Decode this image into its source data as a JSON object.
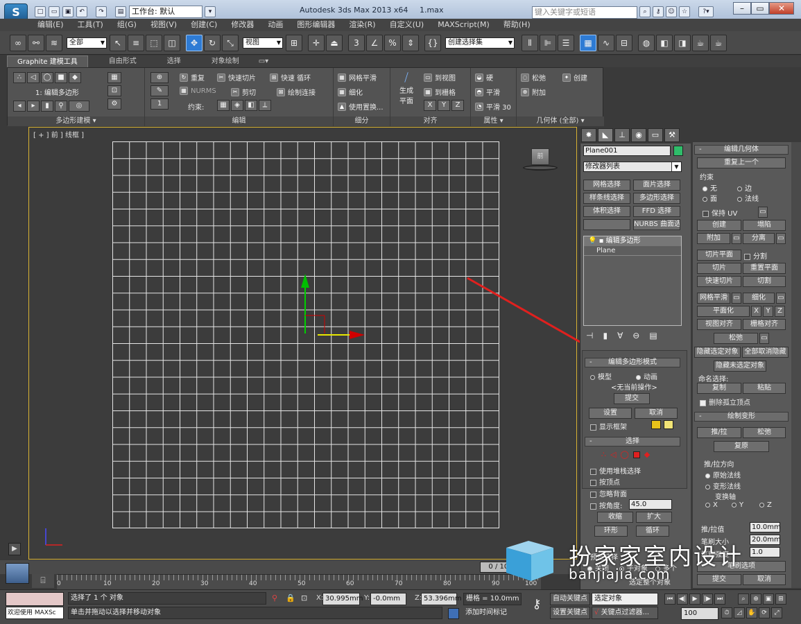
{
  "window": {
    "app_title": "Autodesk 3ds Max  2013 x64",
    "file": "1.max",
    "workspace_label": "工作台: 默认",
    "search_placeholder": "键入关键字或短语"
  },
  "menu": [
    "编辑(E)",
    "工具(T)",
    "组(G)",
    "视图(V)",
    "创建(C)",
    "修改器",
    "动画",
    "图形编辑器",
    "渲染(R)",
    "自定义(U)",
    "MAXScript(M)",
    "帮助(H)"
  ],
  "toolbar": {
    "filter_value": "全部",
    "refcoord_value": "视图",
    "selset_value": "创建选择集"
  },
  "ribbon": {
    "tabs": [
      "Graphite 建模工具",
      "自由形式",
      "选择",
      "对象绘制"
    ],
    "poly_mode_label": "1: 编辑多边形",
    "group_footers": [
      "多边形建模 ▾",
      "编辑",
      "细分",
      "对齐",
      "属性 ▾",
      "几何体 (全部) ▾"
    ],
    "spinner_value": "1",
    "edit": [
      "重复",
      "快速切片",
      "快速 循环",
      "NURMS",
      "剪切",
      "绘制连接",
      "约束:"
    ],
    "subdiv": [
      "网格平滑",
      "细化",
      "使用置换..."
    ],
    "align": [
      "生成\n平面",
      "到视图",
      "到栅格"
    ],
    "align_xyz": [
      "X",
      "Y",
      "Z"
    ],
    "props": [
      "硬",
      "平滑",
      "平滑 30"
    ],
    "geom": [
      "松弛",
      "创建",
      "附加"
    ]
  },
  "viewport": {
    "label": "[ + ] 前 ] 线框 ]",
    "cube_label": "前"
  },
  "command_panel": {
    "object_name": "Plane001",
    "object_color": "#2fbd6a",
    "modifier_list": "修改器列表",
    "mod_buttons": [
      "网格选择",
      "面片选择",
      "样条线选择",
      "多边形选择",
      "体积选择",
      "FFD 选择",
      "NURBS 曲面选择"
    ],
    "stack": [
      "编辑多边形",
      "Plane"
    ],
    "edit_poly_mode": {
      "title": "编辑多边形模式",
      "opt_model": "模型",
      "opt_anim": "动画",
      "no_op": "<无当前操作>",
      "commit": "提交",
      "settings": "设置",
      "cancel": "取消",
      "show_cage": "显示框架"
    },
    "selection": {
      "title": "选择",
      "use_stack": "使用堆栈选择",
      "by_vertex": "按顶点",
      "ignore_back": "忽略背面",
      "by_angle": "按角度:",
      "angle_value": "45.0",
      "shrink": "收缩",
      "grow": "扩大",
      "ring": "环形",
      "loop": "循环",
      "preview": "预览选择",
      "off": "关闭",
      "subobj": "子对象",
      "multi": "多个",
      "whole": "选定整个对象"
    }
  },
  "right_panel": {
    "edit_geom": {
      "title": "编辑几何体",
      "repeat": "重复上一个",
      "constraint": "约束",
      "none": "无",
      "edge": "边",
      "face": "面",
      "normal": "法线",
      "keep_uv": "保持 UV",
      "create": "创建",
      "collapse": "塌陷",
      "attach": "附加",
      "detach": "分离",
      "slice_plane": "切片平面",
      "split": "分割",
      "slice": "切片",
      "reset_plane": "重置平面",
      "quickslice": "快速切片",
      "cut": "切割",
      "msmooth": "网格平滑",
      "tessellate": "细化",
      "planarize": "平面化",
      "x": "X",
      "y": "Y",
      "z": "Z",
      "view_align": "视图对齐",
      "grid_align": "栅格对齐",
      "relax": "松弛",
      "hide_sel": "隐藏选定对象",
      "unhide_all": "全部取消隐藏",
      "hide_unsel": "隐藏未选定对象",
      "named_sel": "命名选择:",
      "copy": "复制",
      "paste": "粘贴",
      "del_iso": "删除孤立顶点"
    },
    "paint_deform": {
      "title": "绘制变形",
      "push_pull": "推/拉",
      "relax": "松弛",
      "revert": "复原",
      "dir": "推/拉方向",
      "orig_normal": "原始法线",
      "deformed_normal": "变形法线",
      "transform_axis": "变换轴",
      "x": "X",
      "y": "Y",
      "z": "Z",
      "pp_value_label": "推/拉值",
      "pp_value": "10.0mm",
      "brush_size_label": "笔刷大小",
      "brush_size": "20.0mm",
      "brush_strength_label": "笔刷强度",
      "brush_strength": "1.0",
      "brush_opts": "笔刷选项",
      "commit": "提交",
      "cancel": "取消"
    }
  },
  "timeline": {
    "frame_range": "0 / 100",
    "ticks": [
      "0",
      "10",
      "20",
      "30",
      "40",
      "50",
      "60",
      "70",
      "80",
      "90",
      "100"
    ]
  },
  "status": {
    "welcome": "欢迎使用 MAXSc",
    "selected": "选择了 1 个 对象",
    "prompt": "单击并拖动以选择并移动对象",
    "x_value": "30.995mm",
    "y_value": "-0.0mm",
    "z_value": "53.396mm",
    "grid": "栅格 = 10.0mm",
    "auto_key": "自动关键点",
    "set_key": "设置关键点",
    "sel_obj": "选定对象",
    "key_filter": "关键点过滤器...",
    "add_time_tag": "添加时间标记",
    "frame": "100"
  },
  "watermark": {
    "cn": "扮家家室内设计",
    "url": "banjiajia.com"
  }
}
